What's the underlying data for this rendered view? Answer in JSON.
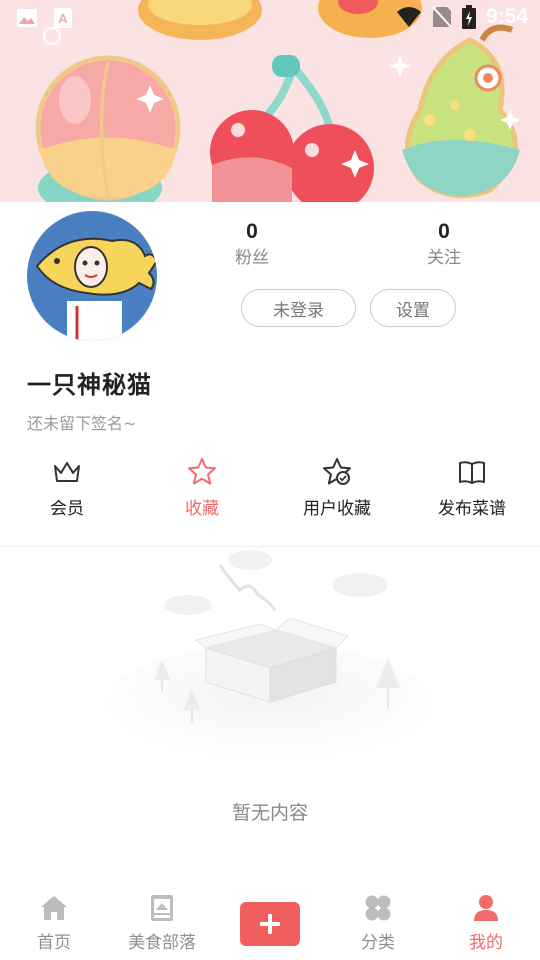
{
  "status_bar": {
    "time": "9:54",
    "left_icons": [
      "image-icon",
      "text-a-icon",
      "circle-icon"
    ],
    "right_icons": [
      "wifi-icon",
      "no-sim-icon",
      "battery-charging-icon"
    ]
  },
  "banner": {
    "description_icons": [
      "peach-icon",
      "cherries-icon",
      "pear-icon"
    ]
  },
  "profile": {
    "avatar_icon": "taiyaki-avatar",
    "username": "一只神秘猫",
    "signature": "还未留下签名~",
    "stats": [
      {
        "value": "0",
        "label": "粉丝"
      },
      {
        "value": "0",
        "label": "关注"
      }
    ],
    "login_button": "未登录",
    "settings_button": "设置"
  },
  "actions": [
    {
      "label": "会员",
      "icon": "crown-icon"
    },
    {
      "label": "收藏",
      "icon": "star-icon",
      "active": true
    },
    {
      "label": "用户收藏",
      "icon": "star-check-icon"
    },
    {
      "label": "发布菜谱",
      "icon": "book-icon"
    }
  ],
  "empty_state": {
    "text": "暂无内容",
    "icon": "empty-box-illustration"
  },
  "tabbar": {
    "tabs": [
      {
        "label": "首页",
        "icon": "home-icon"
      },
      {
        "label": "美食部落",
        "icon": "tribe-icon"
      },
      {
        "label": "",
        "icon": "plus-icon"
      },
      {
        "label": "分类",
        "icon": "category-icon"
      },
      {
        "label": "我的",
        "icon": "person-icon",
        "active": true
      }
    ]
  },
  "colors": {
    "accent": "#f26b6b",
    "add_button": "#f25f5f",
    "banner_bg": "#fbe3e4",
    "avatar_bg": "#4a7fc2"
  }
}
